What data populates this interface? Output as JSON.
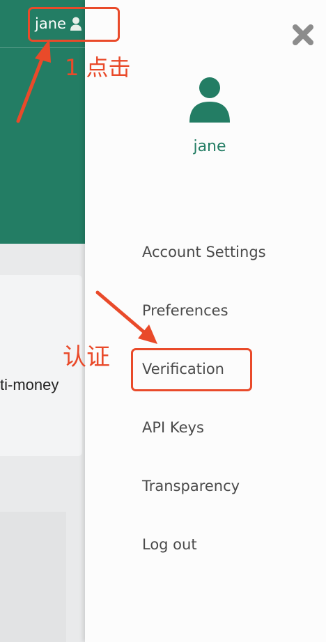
{
  "background_app": {
    "header_color": "#237d64",
    "partial_text": "ti-money"
  },
  "header": {
    "username": "jane",
    "user_icon": "user-icon"
  },
  "drawer": {
    "close_icon": "close-icon",
    "avatar_icon": "user-avatar-icon",
    "username": "jane",
    "menu": [
      {
        "label": "Account Settings"
      },
      {
        "label": "Preferences"
      },
      {
        "label": "Verification"
      },
      {
        "label": "API Keys"
      },
      {
        "label": "Transparency"
      },
      {
        "label": "Log out"
      }
    ]
  },
  "annotations": {
    "step1": "1 点击",
    "step2": "认证",
    "color": "#e94a2a"
  }
}
